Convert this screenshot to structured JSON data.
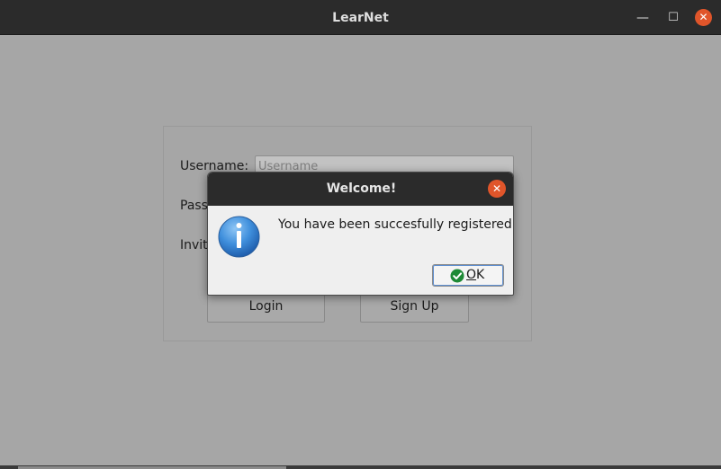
{
  "window": {
    "title": "LearNet",
    "controls": {
      "minimize": "—",
      "maximize": "☐",
      "close": "✕"
    }
  },
  "login_form": {
    "username_label": "Username:",
    "username_placeholder": "Username",
    "password_label": "Pass",
    "invite_label": "Invit",
    "login_button": "Login",
    "signup_button": "Sign Up"
  },
  "dialog": {
    "title": "Welcome!",
    "close": "✕",
    "icon": "information-icon",
    "message": "You have been succesfully registered",
    "ok_mnemonic": "O",
    "ok_rest": "K"
  },
  "colors": {
    "titlebar": "#2b2b2b",
    "close_orange": "#e0552a",
    "dim_background": "#a6a6a6",
    "dialog_body": "#efefef",
    "ok_check_green": "#1e8a36",
    "info_blue": "#2c82d6"
  }
}
